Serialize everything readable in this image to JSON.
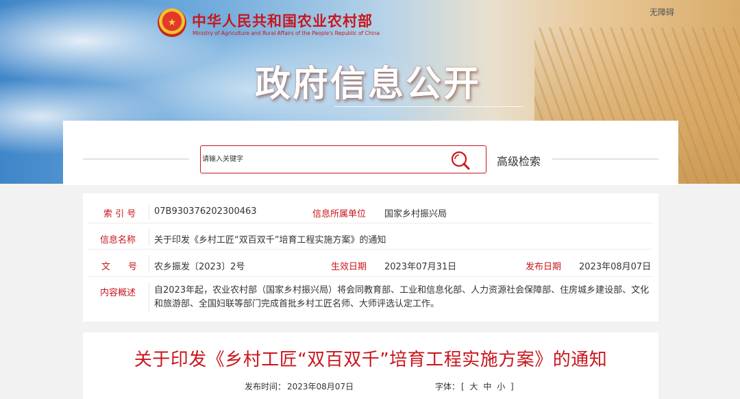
{
  "header": {
    "emblem_icon": "national-emblem-icon",
    "site_name": "中华人民共和国农业农村部",
    "site_name_en": "Ministry of Agriculture and Rural Affairs of the People's Republic of China",
    "accessibility": "无障碍",
    "hero_title": "政府信息公开"
  },
  "search": {
    "placeholder": "请输入关键字",
    "icon": "search-icon",
    "advanced": "高级检索"
  },
  "info": {
    "index_label": "索 引 号",
    "index_value": "07B930376202300463",
    "org_label": "信息所属单位",
    "org_value": "国家乡村振兴局",
    "name_label": "信息名称",
    "name_value": "关于印发《乡村工匠“双百双千”培育工程实施方案》的通知",
    "docno_label_1": "文",
    "docno_label_2": "号",
    "docno_value": "农乡振发〔2023〕2号",
    "effective_label": "生效日期",
    "effective_value": "2023年07月31日",
    "publish_label": "发布日期",
    "publish_value": "2023年08月07日",
    "summary_label": "内容概述",
    "summary_value": "自2023年起，农业农村部（国家乡村振兴局）将会同教育部、工业和信息化部、人力资源社会保障部、住房城乡建设部、文化和旅游部、全国妇联等部门完成首批乡村工匠名师、大师评选认定工作。"
  },
  "article": {
    "title": "关于印发《乡村工匠“双百双千”培育工程实施方案》的通知",
    "pub_time_label": "发布时间：",
    "pub_time": "2023年08月07日",
    "font_label": "字体：",
    "font_open": "[",
    "font_large": "大",
    "font_medium": "中",
    "font_small": "小",
    "font_close": "]"
  }
}
